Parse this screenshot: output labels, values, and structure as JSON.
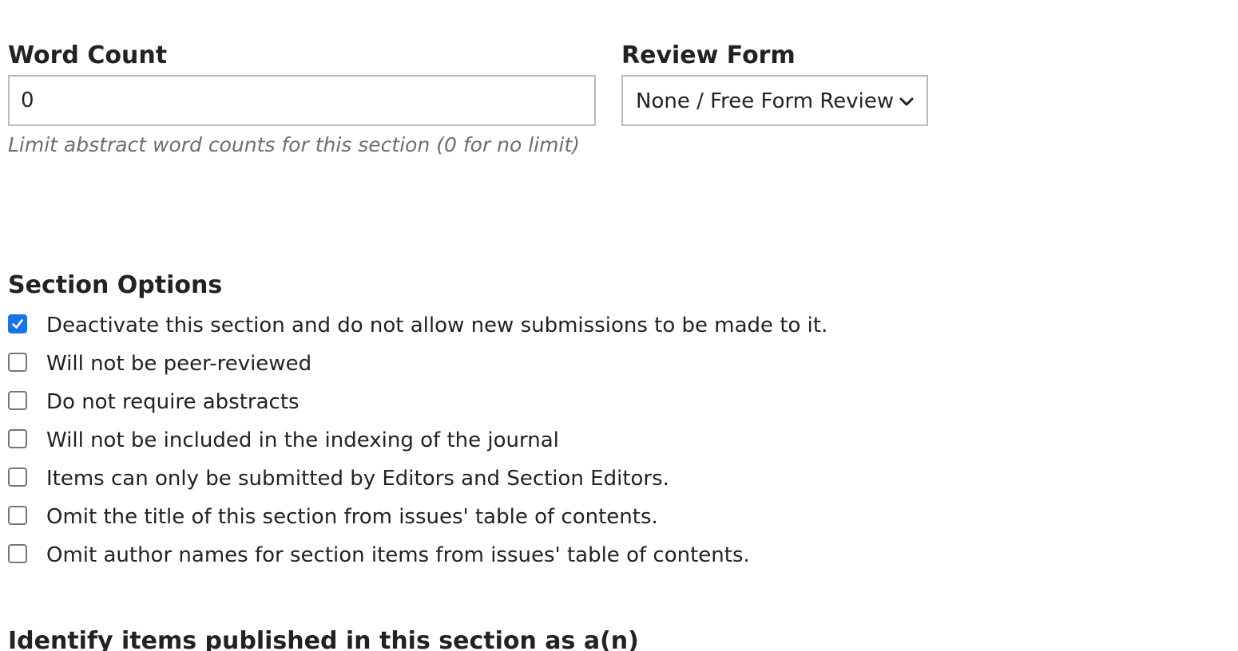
{
  "word_count": {
    "label": "Word Count",
    "value": "0",
    "help": "Limit abstract word counts for this section (0 for no limit)"
  },
  "review_form": {
    "label": "Review Form",
    "selected": "None / Free Form Review"
  },
  "section_options": {
    "title": "Section Options",
    "items": [
      {
        "label": "Deactivate this section and do not allow new submissions to be made to it.",
        "checked": true
      },
      {
        "label": "Will not be peer-reviewed",
        "checked": false
      },
      {
        "label": "Do not require abstracts",
        "checked": false
      },
      {
        "label": "Will not be included in the indexing of the journal",
        "checked": false
      },
      {
        "label": "Items can only be submitted by Editors and Section Editors.",
        "checked": false
      },
      {
        "label": "Omit the title of this section from issues' table of contents.",
        "checked": false
      },
      {
        "label": "Omit author names for section items from issues' table of contents.",
        "checked": false
      }
    ]
  },
  "identify": {
    "label": "Identify items published in this section as a(n)"
  },
  "colors": {
    "checkbox_checked": "#1a73e8",
    "help_text": "#6e6e6e",
    "border": "#bbbbbb"
  }
}
